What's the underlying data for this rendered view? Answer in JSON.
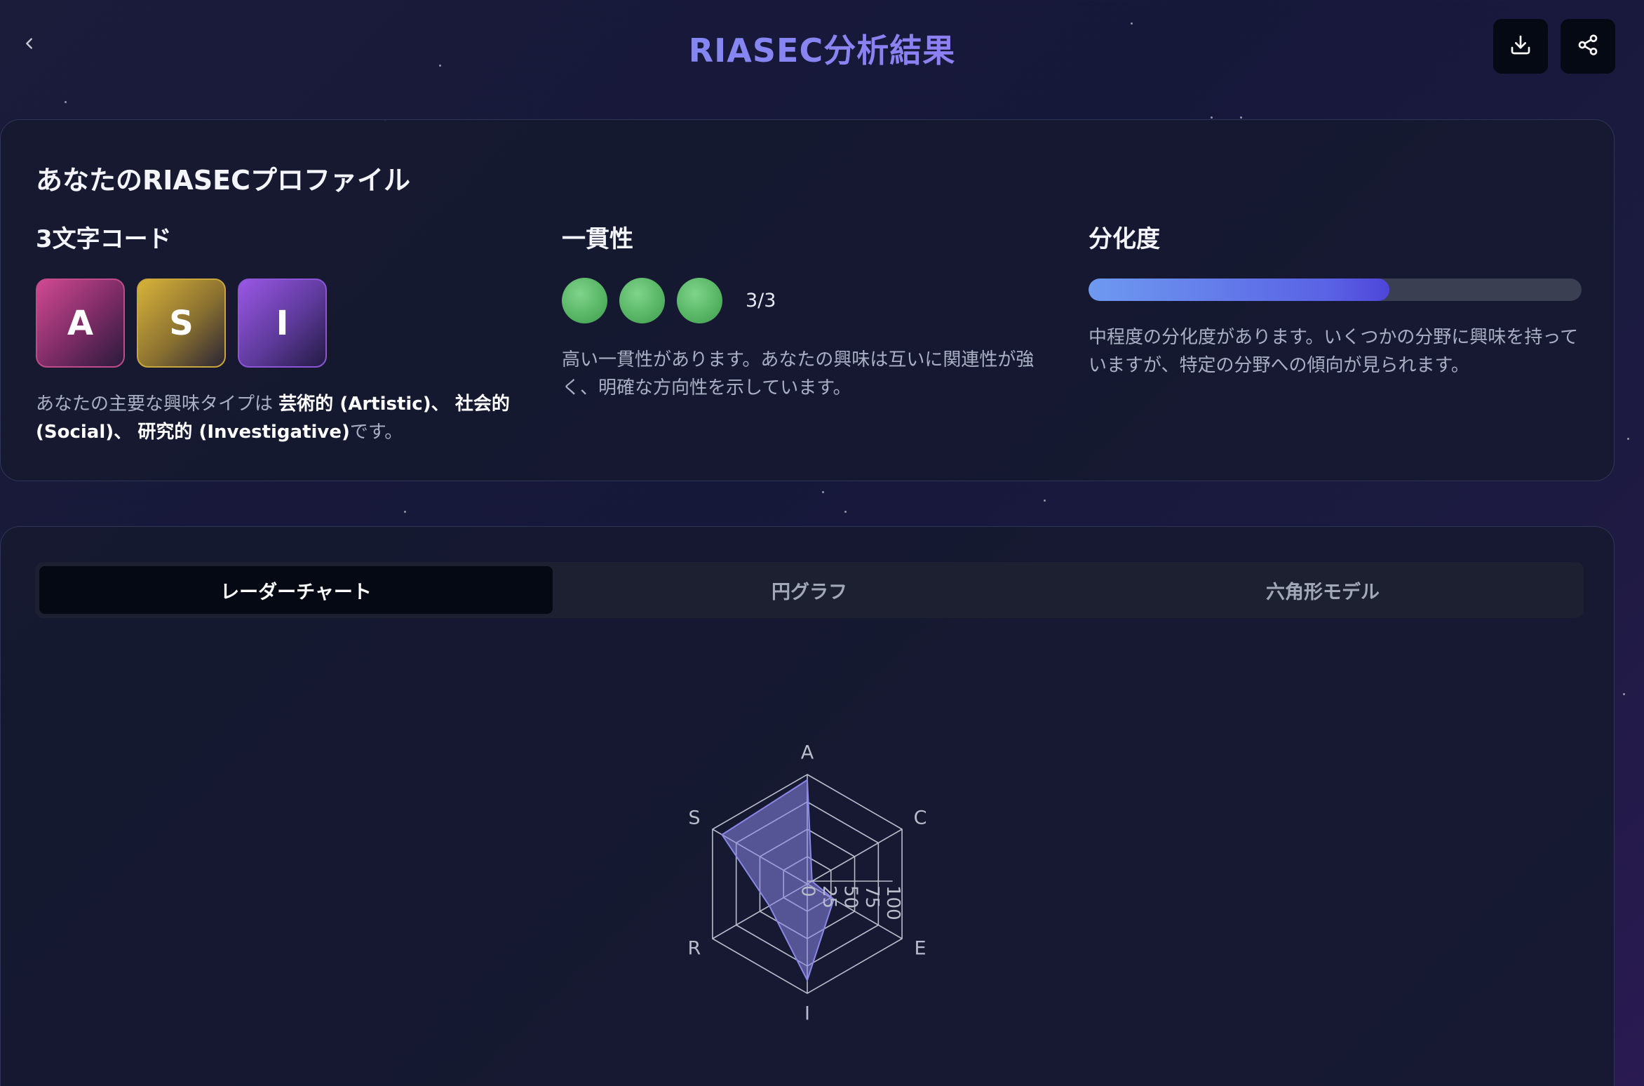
{
  "header": {
    "title": "RIASEC分析結果",
    "back_icon": "chevron-left-icon",
    "download_icon": "download-icon",
    "share_icon": "share-icon"
  },
  "profile": {
    "title": "あなたのRIASECプロファイル",
    "code": {
      "heading": "3文字コード",
      "letters": [
        "A",
        "S",
        "I"
      ],
      "desc_prefix": "あなたの主要な興味タイプは ",
      "type1": "芸術的 (Artistic)、",
      "sep1": " ",
      "type2": "社会的 (Social)、",
      "sep2": " ",
      "type3": "研究的 (Investigative)",
      "desc_suffix": "です。"
    },
    "consistency": {
      "heading": "一貫性",
      "score": "3/3",
      "score_value": 3,
      "score_max": 3,
      "desc": "高い一貫性があります。あなたの興味は互いに関連性が強く、明確な方向性を示しています。"
    },
    "differentiation": {
      "heading": "分化度",
      "level_fraction": 0.61,
      "desc": "中程度の分化度があります。いくつかの分野に興味を持っていますが、特定の分野への傾向が見られます。"
    },
    "colors": {
      "A": "#d14a93",
      "S": "#d8b33a",
      "I": "#9a58e6",
      "consistency": "#5cb968"
    }
  },
  "tabs": [
    {
      "label": "レーダーチャート",
      "active": true
    },
    {
      "label": "円グラフ",
      "active": false
    },
    {
      "label": "六角形モデル",
      "active": false
    }
  ],
  "chart_data": {
    "type": "radar",
    "axes": [
      "A",
      "C",
      "E",
      "I",
      "R",
      "S"
    ],
    "values": [
      95,
      5,
      28,
      88,
      40,
      90
    ],
    "range": [
      0,
      100
    ],
    "ticks": [
      "0",
      "25",
      "50",
      "75",
      "100"
    ],
    "tick_values": [
      0,
      25,
      50,
      75,
      100
    ],
    "fill_color": "#8b86e8"
  }
}
